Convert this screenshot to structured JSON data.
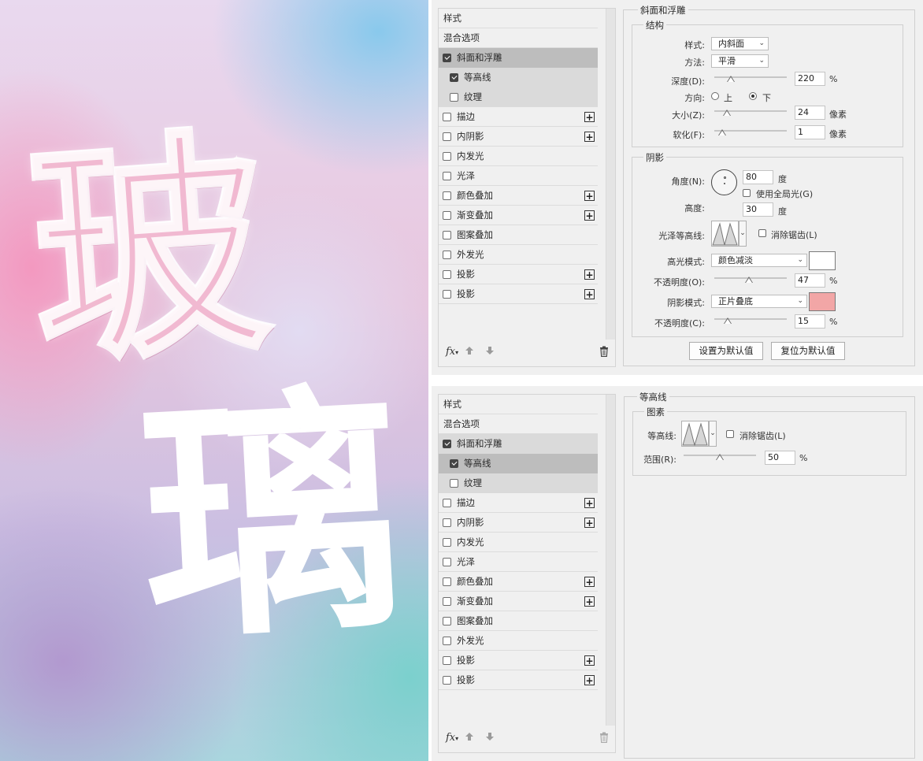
{
  "artwork": {
    "glass_char": "玻",
    "solid_char": "璃",
    "colors": {
      "pink": "#f496be",
      "blue": "#84c8ec",
      "purple": "#b296ce",
      "teal": "#78d0cc"
    }
  },
  "style_list": {
    "header": "样式",
    "blend_options": "混合选项",
    "bevel": {
      "label": "斜面和浮雕",
      "checked": true
    },
    "contour": {
      "label": "等高线",
      "checked": true
    },
    "texture": {
      "label": "纹理",
      "checked": false
    },
    "stroke": {
      "label": "描边",
      "plus": true
    },
    "inner_shadow": {
      "label": "内阴影",
      "plus": true
    },
    "inner_glow": {
      "label": "内发光"
    },
    "satin": {
      "label": "光泽"
    },
    "color_overlay": {
      "label": "颜色叠加",
      "plus": true
    },
    "gradient_overlay": {
      "label": "渐变叠加",
      "plus": true
    },
    "pattern_overlay": {
      "label": "图案叠加"
    },
    "outer_glow": {
      "label": "外发光"
    },
    "drop_shadow_1": {
      "label": "投影",
      "plus": true
    },
    "drop_shadow_2": {
      "label": "投影",
      "plus": true
    },
    "footer": {
      "fx": "fx",
      "icons": [
        "up-arrow-icon",
        "down-arrow-icon",
        "trash-icon"
      ]
    }
  },
  "bevel_panel": {
    "title": "斜面和浮雕",
    "structure": {
      "title": "结构",
      "style_label": "样式:",
      "style_value": "内斜面",
      "method_label": "方法:",
      "method_value": "平滑",
      "depth_label": "深度(D):",
      "depth_value": "220",
      "depth_unit": "%",
      "depth_slider": 0.2,
      "direction_label": "方向:",
      "dir_up": "上",
      "dir_down": "下",
      "dir_selected": "下",
      "size_label": "大小(Z):",
      "size_value": "24",
      "size_unit": "像素",
      "size_slider": 0.14,
      "soften_label": "软化(F):",
      "soften_value": "1",
      "soften_unit": "像素",
      "soften_slider": 0.06
    },
    "shading": {
      "title": "阴影",
      "angle_label": "角度(N):",
      "angle_value": "80",
      "angle_unit": "度",
      "global_light_label": "使用全局光(G)",
      "global_light_checked": false,
      "altitude_label": "高度:",
      "altitude_value": "30",
      "altitude_unit": "度",
      "gloss_contour_label": "光泽等高线:",
      "anti_alias_label": "消除锯齿(L)",
      "anti_alias_checked": false,
      "highlight_mode_label": "高光模式:",
      "highlight_mode_value": "颜色减淡",
      "highlight_color": "#ffffff",
      "highlight_opacity_label": "不透明度(O):",
      "highlight_opacity_value": "47",
      "highlight_opacity_unit": "%",
      "highlight_opacity_slider": 0.47,
      "shadow_mode_label": "阴影模式:",
      "shadow_mode_value": "正片叠底",
      "shadow_color": "#f2a6a6",
      "shadow_opacity_label": "不透明度(C):",
      "shadow_opacity_value": "15",
      "shadow_opacity_unit": "%",
      "shadow_opacity_slider": 0.15
    },
    "buttons": {
      "set_default": "设置为默认值",
      "reset_default": "复位为默认值"
    }
  },
  "contour_panel": {
    "title": "等高线",
    "elements": {
      "title": "图素",
      "contour_label": "等高线:",
      "anti_alias_label": "消除锯齿(L)",
      "anti_alias_checked": false,
      "range_label": "范围(R):",
      "range_value": "50",
      "range_unit": "%",
      "range_slider": 0.5
    }
  }
}
